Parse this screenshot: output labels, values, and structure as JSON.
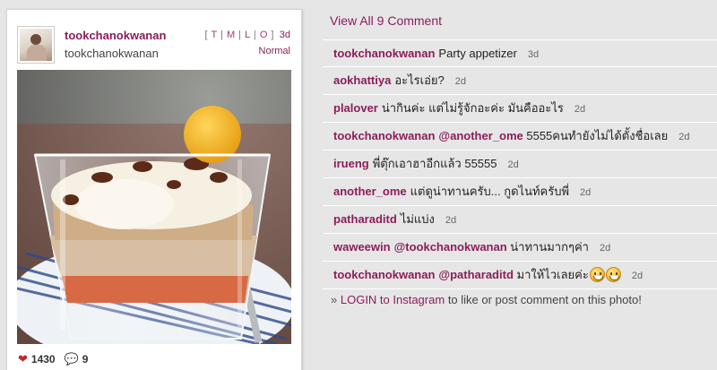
{
  "photo_card": {
    "username": "tookchanokwanan",
    "full_name": "tookchanokwanan",
    "size_links": [
      "T",
      "M",
      "L",
      "O"
    ],
    "time_ago": "3d",
    "filter": "Normal",
    "likes": "1430",
    "comments_count": "9"
  },
  "comments_section": {
    "view_all": "View All 9 Comment",
    "comments": [
      {
        "user": "tookchanokwanan",
        "mention": "",
        "text": "Party appetizer",
        "time": "3d",
        "emoji_count": 0
      },
      {
        "user": "aokhattiya",
        "mention": "",
        "text": "อะไรเอ่ย?",
        "time": "2d",
        "emoji_count": 0
      },
      {
        "user": "plalover",
        "mention": "",
        "text": "น่ากินค่ะ แต่ไม่รู้จักอะค่ะ มันคืออะไร",
        "time": "2d",
        "emoji_count": 0
      },
      {
        "user": "tookchanokwanan",
        "mention": "@another_ome",
        "text": "5555คนทำยังไม่ได้ตั้งชื่อเลย",
        "time": "2d",
        "emoji_count": 0
      },
      {
        "user": "irueng",
        "mention": "",
        "text": "พี่ตุ๊กเอาฮาอีกแล้ว 55555",
        "time": "2d",
        "emoji_count": 0
      },
      {
        "user": "another_ome",
        "mention": "",
        "text": "แต่ดูน่าทานครับ... กูดไนท์ครับพี่",
        "time": "2d",
        "emoji_count": 0
      },
      {
        "user": "patharaditd",
        "mention": "",
        "text": "ไม่แบ่ง",
        "time": "2d",
        "emoji_count": 0
      },
      {
        "user": "waweewin",
        "mention": "@tookchanokwanan",
        "text": "น่าทานมากๆค่า",
        "time": "2d",
        "emoji_count": 0
      },
      {
        "user": "tookchanokwanan",
        "mention": "@patharaditd",
        "text": "มาให้ไวเลยค่ะ",
        "time": "2d",
        "emoji_count": 2
      }
    ],
    "login_prefix": "»",
    "login_link": "LOGIN to Instagram",
    "login_suffix": "to like or post comment on this photo!"
  },
  "colors": {
    "accent": "#8a1e5a",
    "heart": "#c1272d",
    "comment_icon": "#2b8fb3",
    "background": "#e6e6e6"
  },
  "icons": [
    "heart-icon",
    "comment-bubble-icon"
  ]
}
